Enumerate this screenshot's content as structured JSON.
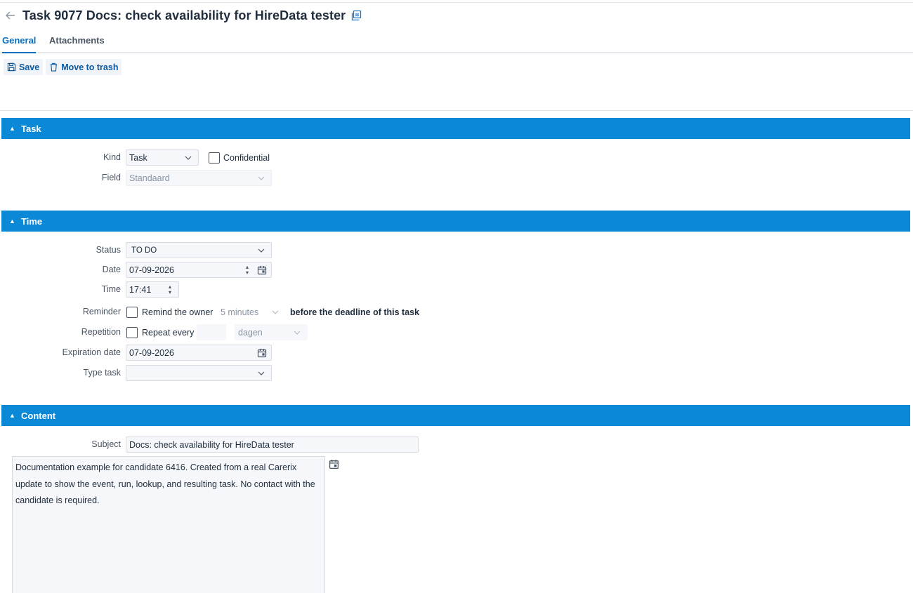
{
  "header": {
    "title": "Task 9077 Docs: check availability for HireData tester",
    "back_icon": "arrow-left-icon",
    "copy_icon": "copy-icon"
  },
  "tabs": [
    {
      "label": "General",
      "active": true
    },
    {
      "label": "Attachments",
      "active": false
    }
  ],
  "toolbar": {
    "save_label": "Save",
    "trash_label": "Move to trash"
  },
  "sections": {
    "task": {
      "title": "Task",
      "kind_label": "Kind",
      "kind_value": "Task",
      "confidential_label": "Confidential",
      "field_label": "Field",
      "field_value": "Standaard"
    },
    "time": {
      "title": "Time",
      "status_label": "Status",
      "status_value": "TO DO",
      "date_label": "Date",
      "date_value": "07-09-2026",
      "time_label": "Time",
      "time_value": "17:41",
      "reminder_label": "Reminder",
      "reminder_text": "Remind the owner",
      "reminder_value": "5 minutes",
      "reminder_suffix": "before the deadline of this task",
      "repetition_label": "Repetition",
      "repeat_text": "Repeat every",
      "repeat_count": "",
      "repeat_unit": "dagen",
      "expiration_label": "Expiration date",
      "expiration_value": "07-09-2026",
      "type_label": "Type task",
      "type_value": ""
    },
    "content": {
      "title": "Content",
      "subject_label": "Subject",
      "subject_value": "Docs: check availability for HireData tester",
      "notes_lines": [
        "Documentation example for candidate 6416. Created from a real Carerix",
        "update to show the event, run, lookup, and resulting task. No contact with the",
        "candidate is required."
      ]
    }
  },
  "colors": {
    "section_bar": "#0b88d6",
    "accent": "#0a6fbf"
  }
}
